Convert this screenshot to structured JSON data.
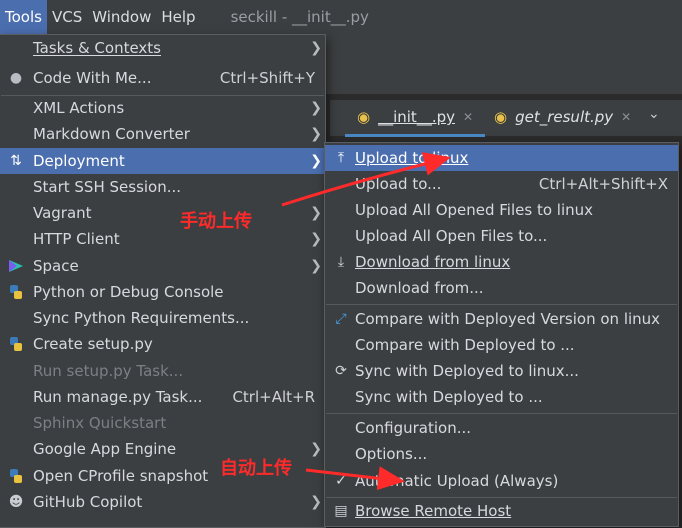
{
  "menubar": {
    "items": [
      "Tools",
      "VCS",
      "Window",
      "Help"
    ],
    "title": "seckill - __init__.py"
  },
  "tabs": [
    {
      "label": "__init__.py"
    },
    {
      "label": "get_result.py"
    }
  ],
  "tools_menu": {
    "items": [
      {
        "label": "Tasks & Contexts",
        "submenu": true
      },
      {
        "label": "Code With Me...",
        "shortcut": "Ctrl+Shift+Y",
        "icon": "users-icon"
      },
      {
        "label": "XML Actions",
        "submenu": true
      },
      {
        "label": "Markdown Converter",
        "submenu": true
      },
      {
        "label": "Deployment",
        "submenu": true,
        "icon": "deployment-icon",
        "selected": true
      },
      {
        "label": "Start SSH Session..."
      },
      {
        "label": "Vagrant",
        "submenu": true
      },
      {
        "label": "HTTP Client",
        "submenu": true
      },
      {
        "label": "Space",
        "submenu": true,
        "icon": "space-icon"
      },
      {
        "label": "Python or Debug Console",
        "icon": "python-icon"
      },
      {
        "label": "Sync Python Requirements..."
      },
      {
        "label": "Create setup.py",
        "icon": "python-icon"
      },
      {
        "label": "Run setup.py Task...",
        "disabled": true
      },
      {
        "label": "Run manage.py Task...",
        "shortcut": "Ctrl+Alt+R"
      },
      {
        "label": "Sphinx Quickstart",
        "disabled": true
      },
      {
        "label": "Google App Engine",
        "submenu": true
      },
      {
        "label": "Open CProfile snapshot",
        "icon": "python-icon"
      },
      {
        "label": "GitHub Copilot",
        "submenu": true,
        "icon": "copilot-icon"
      }
    ]
  },
  "deployment_menu": {
    "items": [
      {
        "label": "Upload to linux",
        "icon": "upload-icon",
        "selected": true
      },
      {
        "label": "Upload to...",
        "shortcut": "Ctrl+Alt+Shift+X"
      },
      {
        "label": "Upload All Opened Files to linux"
      },
      {
        "label": "Upload All Open Files to..."
      },
      {
        "label": "Download from linux",
        "icon": "download-icon"
      },
      {
        "label": "Download from..."
      },
      {
        "label": "Compare with Deployed Version on linux",
        "icon": "compare-icon"
      },
      {
        "label": "Compare with Deployed to ..."
      },
      {
        "label": "Sync with Deployed to linux...",
        "icon": "sync-icon"
      },
      {
        "label": "Sync with Deployed to ..."
      },
      {
        "label": "Configuration..."
      },
      {
        "label": "Options..."
      },
      {
        "label": "Automatic Upload (Always)",
        "icon": "checkmark-icon"
      },
      {
        "label": "Browse Remote Host",
        "icon": "remote-host-icon"
      }
    ]
  },
  "annotations": {
    "manual_upload": "手动上传",
    "auto_upload": "自动上传"
  },
  "colors": {
    "accent": "#4b6eaf",
    "annotation": "#ff2a2a"
  }
}
